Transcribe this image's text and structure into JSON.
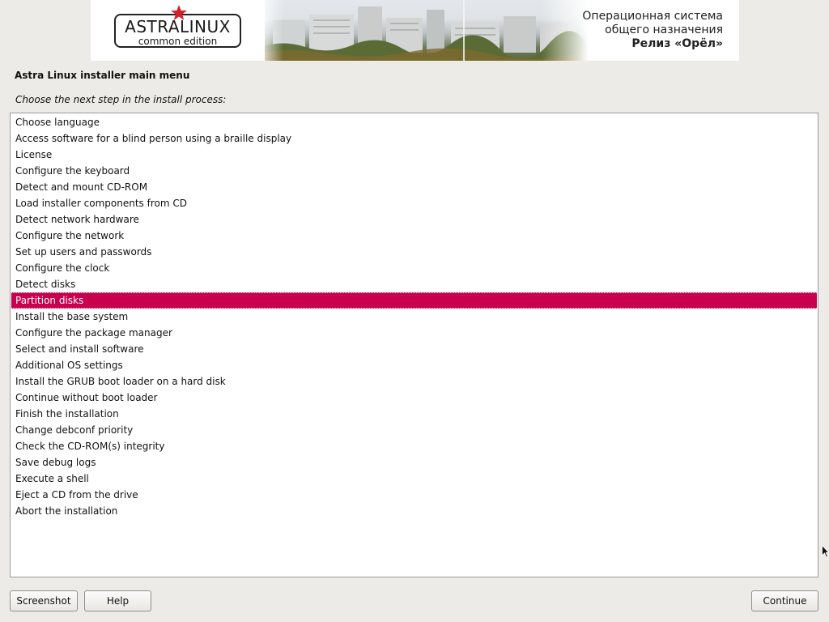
{
  "banner": {
    "logo_text": "ASTRALINUX",
    "logo_sub": "common edition",
    "tagline_line1": "Операционная система",
    "tagline_line2": "общего назначения",
    "release": "Релиз «Орёл»"
  },
  "menu": {
    "title": "Astra Linux installer main menu",
    "prompt": "Choose the next step in the install process:",
    "selected_index": 11,
    "items": [
      "Choose language",
      "Access software for a blind person using a braille display",
      "License",
      "Configure the keyboard",
      "Detect and mount CD-ROM",
      "Load installer components from CD",
      "Detect network hardware",
      "Configure the network",
      "Set up users and passwords",
      "Configure the clock",
      "Detect disks",
      "Partition disks",
      "Install the base system",
      "Configure the package manager",
      "Select and install software",
      "Additional OS settings",
      "Install the GRUB boot loader on a hard disk",
      "Continue without boot loader",
      "Finish the installation",
      "Change debconf priority",
      "Check the CD-ROM(s) integrity",
      "Save debug logs",
      "Execute a shell",
      "Eject a CD from the drive",
      "Abort the installation"
    ]
  },
  "buttons": {
    "screenshot": "Screenshot",
    "help": "Help",
    "continue": "Continue"
  },
  "colors": {
    "background": "#edebe7",
    "selection": "#c8004e",
    "logo_star": "#d3202a"
  }
}
